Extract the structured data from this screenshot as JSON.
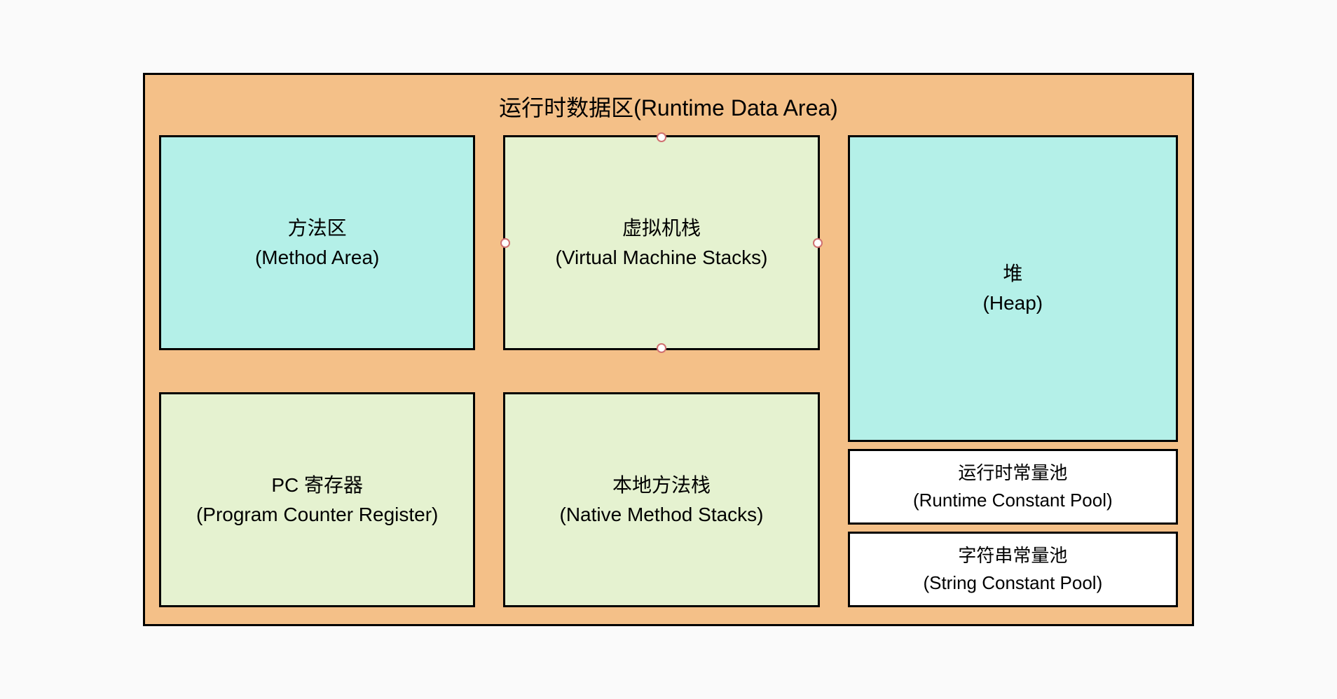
{
  "diagram": {
    "title": "运行时数据区(Runtime Data Area)",
    "boxes": {
      "method_area": {
        "line1": "方法区",
        "line2": "(Method Area)",
        "color": "cyan"
      },
      "vm_stacks": {
        "line1": "虚拟机栈",
        "line2": "(Virtual Machine Stacks)",
        "color": "green",
        "selected": true
      },
      "pc_register": {
        "line1": "PC 寄存器",
        "line2": "(Program Counter Register)",
        "color": "green"
      },
      "native_stacks": {
        "line1": "本地方法栈",
        "line2": "(Native Method Stacks)",
        "color": "green"
      },
      "heap": {
        "line1": "堆",
        "line2": "(Heap)",
        "color": "cyan"
      },
      "runtime_constant_pool": {
        "line1": "运行时常量池",
        "line2": "(Runtime Constant Pool)",
        "color": "white"
      },
      "string_constant_pool": {
        "line1": "字符串常量池",
        "line2": "(String Constant Pool)",
        "color": "white"
      }
    },
    "colors": {
      "container_bg": "#F4C088",
      "cyan": "#B4F0E8",
      "green": "#E5F2D0",
      "white": "#FFFFFF",
      "border": "#000000"
    }
  }
}
